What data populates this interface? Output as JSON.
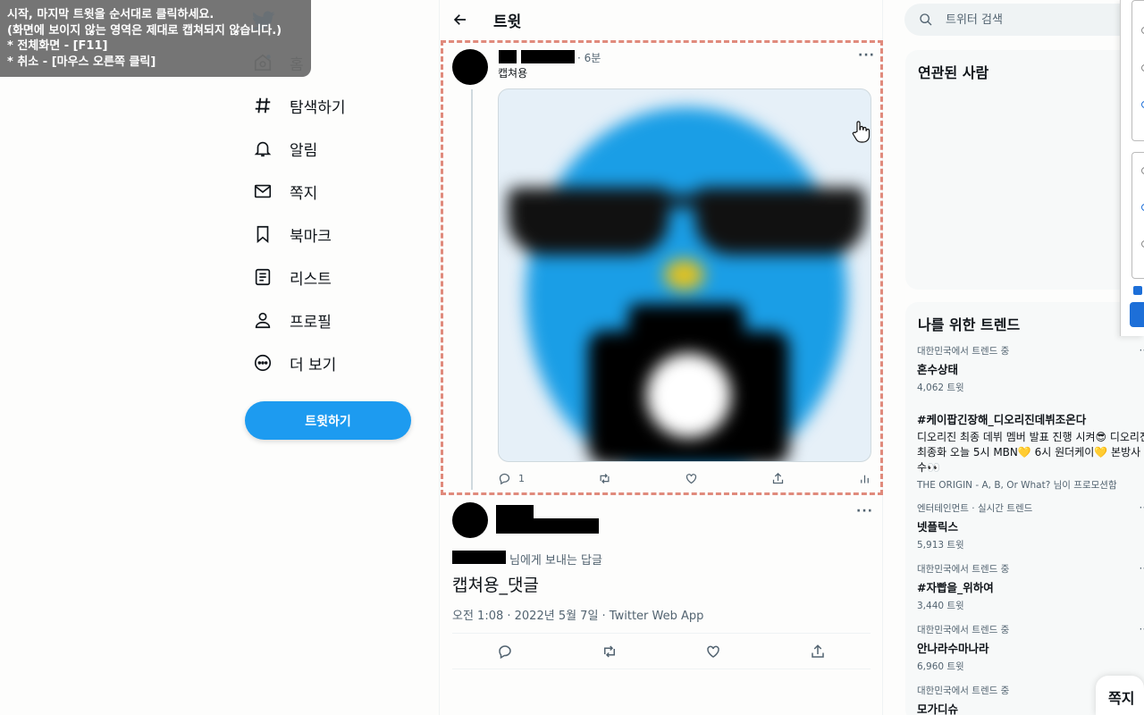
{
  "overlay": {
    "line1": "시작, 마지막 트윗을 순서대로 클릭하세요.",
    "line2": "(화면에 보이지 않는 영역은 제대로 캡쳐되지 않습니다.)",
    "line3": "* 전체화면 - [F11]",
    "line4": "* 취소 - [마우스 오른쪽 클릭]"
  },
  "nav": {
    "items": [
      {
        "label": "홈",
        "icon": "home-icon"
      },
      {
        "label": "탐색하기",
        "icon": "hashtag-icon"
      },
      {
        "label": "알림",
        "icon": "bell-icon"
      },
      {
        "label": "쪽지",
        "icon": "mail-icon"
      },
      {
        "label": "북마크",
        "icon": "bookmark-icon"
      },
      {
        "label": "리스트",
        "icon": "list-icon"
      },
      {
        "label": "프로필",
        "icon": "profile-icon"
      },
      {
        "label": "더 보기",
        "icon": "more-circle-icon"
      }
    ],
    "tweet_button": "트윗하기"
  },
  "center": {
    "title": "트윗",
    "tweet": {
      "time": "· 6분",
      "caption": "캡쳐용",
      "reply_count": "1",
      "more": "···"
    },
    "reply": {
      "reply_to_suffix": "님에게 보내는 답글",
      "text": "캡쳐용_댓글",
      "meta": "오전 1:08 · 2022년 5월 7일 · Twitter Web App",
      "more": "···"
    }
  },
  "right": {
    "search_placeholder": "트위터 검색",
    "related_title": "연관된 사람",
    "trends_title": "나를 위한 트렌드",
    "trends": [
      {
        "context": "대한민국에서 트렌드 중",
        "name": "혼수상태",
        "count": "4,062 트윗"
      },
      {
        "context": "",
        "name": "#케이팝긴장해_디오리진데뷔조온다",
        "desc": "디오리진 최종 데뷔 멤버 발표 진행 시켜😎 디오리진 최종화 오늘 5시 MBN💛 6시 원더케이💛 본방사수👀",
        "promo": "THE ORIGIN - A, B, Or What? 님이 프로모션함"
      },
      {
        "context": "엔터테인먼트 · 실시간 트렌드",
        "name": "넷플릭스",
        "count": "5,913 트윗"
      },
      {
        "context": "대한민국에서 트렌드 중",
        "name": "#자빱을_위하여",
        "count": "3,440 트윗"
      },
      {
        "context": "대한민국에서 트렌드 중",
        "name": "안나라수마나라",
        "count": "6,960 트윗"
      },
      {
        "context": "대한민국에서 트렌드 중",
        "name": "모가디슈",
        "count": ""
      }
    ],
    "trend_more": "···",
    "dm_tab": "쪽지"
  },
  "colors": {
    "accent": "#1d9bf0",
    "capture_border": "#e08a7c"
  }
}
